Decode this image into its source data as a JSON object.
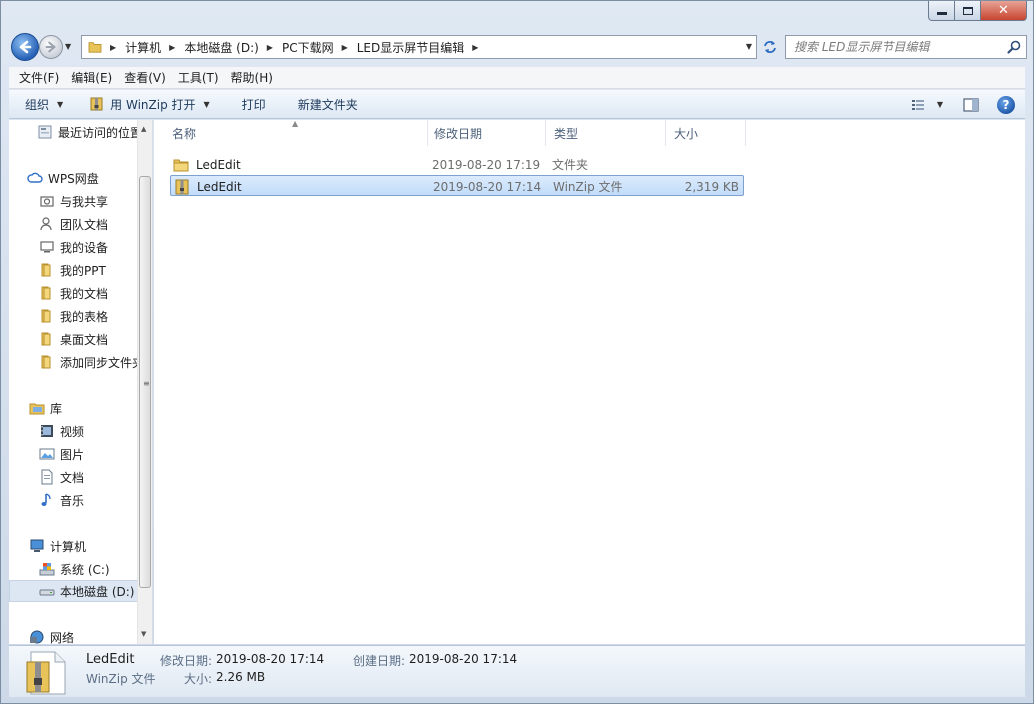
{
  "window": {
    "caption": {
      "min": "",
      "max": "",
      "close": "✕"
    }
  },
  "address": {
    "crumbs": [
      "计算机",
      "本地磁盘 (D:)",
      "PC下载网",
      "LED显示屏节目编辑"
    ]
  },
  "search": {
    "placeholder": "搜索 LED显示屏节目编辑"
  },
  "menu": {
    "items": [
      "文件(F)",
      "编辑(E)",
      "查看(V)",
      "工具(T)",
      "帮助(H)"
    ]
  },
  "toolbar": {
    "organize": "组织",
    "open_with": "用 WinZip 打开",
    "print": "打印",
    "new_folder": "新建文件夹",
    "help": "?"
  },
  "nav": {
    "recent": "最近访问的位置",
    "wps": "WPS网盘",
    "wps_items": [
      "与我共享",
      "团队文档",
      "我的设备",
      "我的PPT",
      "我的文档",
      "我的表格",
      "桌面文档",
      "添加同步文件夹"
    ],
    "libraries": "库",
    "lib_items": [
      "视频",
      "图片",
      "文档",
      "音乐"
    ],
    "computer": "计算机",
    "drives": [
      "系统 (C:)",
      "本地磁盘 (D:)"
    ],
    "network": "网络"
  },
  "columns": {
    "name": "名称",
    "date": "修改日期",
    "type": "类型",
    "size": "大小"
  },
  "files": [
    {
      "name": "LedEdit",
      "date": "2019-08-20 17:19",
      "type": "文件夹",
      "size": "",
      "icon": "folder-icon"
    },
    {
      "name": "LedEdit",
      "date": "2019-08-20 17:14",
      "type": "WinZip 文件",
      "size": "2,319 KB",
      "icon": "winzip-file-icon"
    }
  ],
  "details": {
    "name": "LedEdit",
    "type": "WinZip 文件",
    "modified_label": "修改日期:",
    "modified": "2019-08-20 17:14",
    "created_label": "创建日期:",
    "created": "2019-08-20 17:14",
    "size_label": "大小:",
    "size": "2.26 MB"
  },
  "colors": {
    "accent": "#2862b7",
    "selection": "#c1dcfa",
    "folder": "#e8c35a"
  }
}
